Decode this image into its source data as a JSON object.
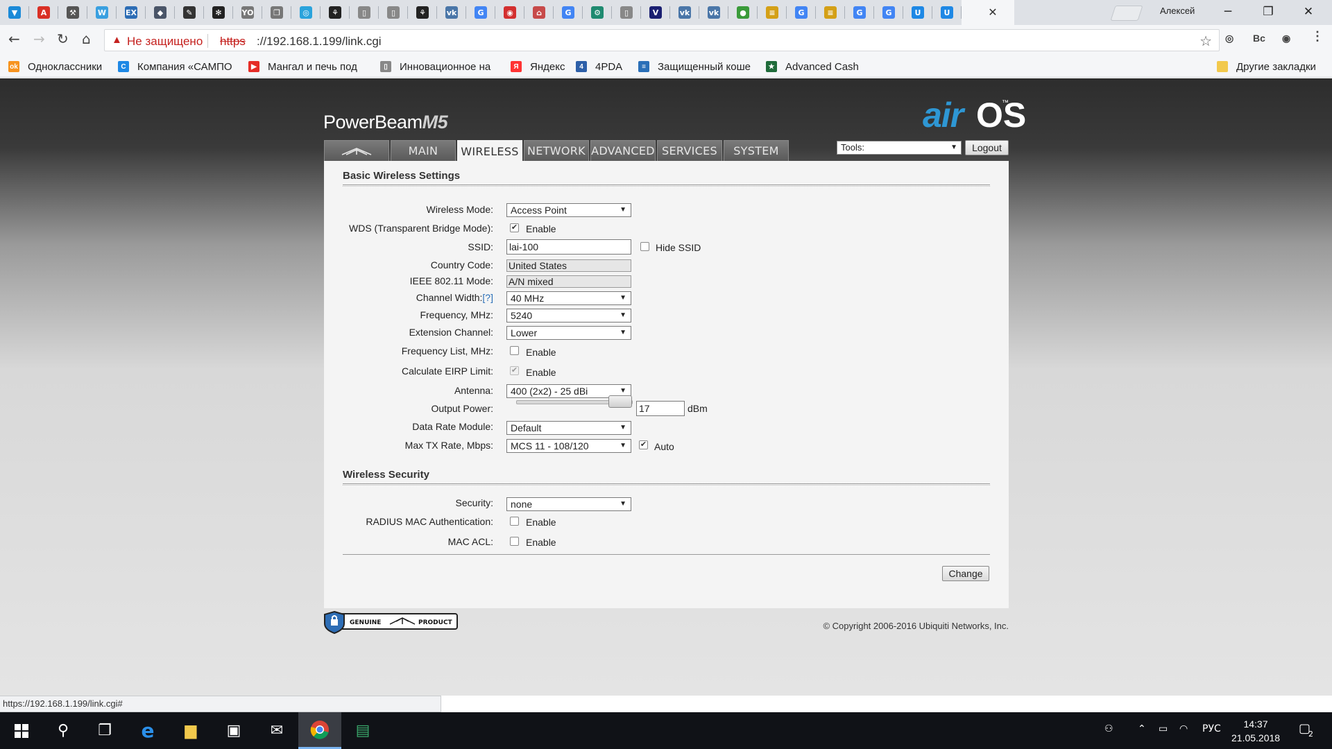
{
  "browser": {
    "tabs": [
      {
        "icon": "vivaldi-icon",
        "color": "#1b8ad8",
        "glyph": "▼"
      },
      {
        "icon": "pdf-icon",
        "color": "#d93025",
        "glyph": "A"
      },
      {
        "icon": "tools-icon",
        "color": "#555555",
        "glyph": "⚒"
      },
      {
        "icon": "w-icon",
        "color": "#3aa0e0",
        "glyph": "W"
      },
      {
        "icon": "ex-icon",
        "color": "#2d6db5",
        "glyph": "EX"
      },
      {
        "icon": "puzzle-icon",
        "color": "#4a5568",
        "glyph": "◆"
      },
      {
        "icon": "lightning-icon",
        "color": "#333333",
        "glyph": "✎"
      },
      {
        "icon": "fan-icon",
        "color": "#222222",
        "glyph": "✻"
      },
      {
        "icon": "yo-icon",
        "color": "#777777",
        "glyph": "YO"
      },
      {
        "icon": "pages-icon",
        "color": "#777777",
        "glyph": "❐"
      },
      {
        "icon": "telegram-icon",
        "color": "#2aa3dc",
        "glyph": "◎"
      },
      {
        "icon": "yoga-icon",
        "color": "#222222",
        "glyph": "⚘"
      },
      {
        "icon": "page-icon",
        "color": "#888888",
        "glyph": "▯"
      },
      {
        "icon": "page-icon",
        "color": "#888888",
        "glyph": "▯"
      },
      {
        "icon": "yoga-icon",
        "color": "#222222",
        "glyph": "⚘"
      },
      {
        "icon": "vk-icon",
        "color": "#4a76a8",
        "glyph": "vk"
      },
      {
        "icon": "google-icon",
        "color": "#4285f4",
        "glyph": "G"
      },
      {
        "icon": "mask-icon",
        "color": "#d32f2f",
        "glyph": "◉"
      },
      {
        "icon": "gift-icon",
        "color": "#c74a4a",
        "glyph": "⌂"
      },
      {
        "icon": "google-icon",
        "color": "#4285f4",
        "glyph": "G"
      },
      {
        "icon": "gear-icon",
        "color": "#1f8a70",
        "glyph": "⚙"
      },
      {
        "icon": "page-icon",
        "color": "#888888",
        "glyph": "▯"
      },
      {
        "icon": "visa-icon",
        "color": "#1a1f71",
        "glyph": "V"
      },
      {
        "icon": "vk-icon",
        "color": "#4a76a8",
        "glyph": "vk"
      },
      {
        "icon": "vk-icon",
        "color": "#4a76a8",
        "glyph": "vk"
      },
      {
        "icon": "ball-icon",
        "color": "#3a9b3a",
        "glyph": "●"
      },
      {
        "icon": "chart-icon",
        "color": "#d4a017",
        "glyph": "≡"
      },
      {
        "icon": "google-icon",
        "color": "#4285f4",
        "glyph": "G"
      },
      {
        "icon": "chart-icon",
        "color": "#d4a017",
        "glyph": "≡"
      },
      {
        "icon": "google-icon",
        "color": "#4285f4",
        "glyph": "G"
      },
      {
        "icon": "google-icon",
        "color": "#4285f4",
        "glyph": "G"
      },
      {
        "icon": "u-icon",
        "color": "#1e88e5",
        "glyph": "U"
      },
      {
        "icon": "u-icon",
        "color": "#1e88e5",
        "glyph": "U"
      }
    ],
    "profile_name": "Алексей",
    "security_label": "Не защищено",
    "url_protocol": "https",
    "url_rest": "://192.168.1.199/link.cgi",
    "status_url": "https://192.168.1.199/link.cgi#"
  },
  "bookmarks": [
    {
      "label": "Одноклассники",
      "color": "#f7931e",
      "glyph": "ok"
    },
    {
      "label": "Компания «САМПО",
      "color": "#1e88e5",
      "glyph": "C"
    },
    {
      "label": "Мангал и печь под",
      "color": "#e52d27",
      "glyph": "▶"
    },
    {
      "label": "Инновационное на",
      "color": "#888888",
      "glyph": "▯"
    },
    {
      "label": "Яндекс",
      "color": "#ff3333",
      "glyph": "Я"
    },
    {
      "label": "4PDA",
      "color": "#2d5fa8",
      "glyph": "4"
    },
    {
      "label": "Защищенный коше",
      "color": "#2a6fb8",
      "glyph": "≡"
    },
    {
      "label": "Advanced Cash",
      "color": "#1f6b3a",
      "glyph": "★"
    }
  ],
  "other_bookmarks": "Другие закладки",
  "device": {
    "product": "PowerBeam",
    "model": "M5",
    "os_air": "air",
    "os_name": "OS",
    "os_tm": "™"
  },
  "nav_tabs": [
    "MAIN",
    "WIRELESS",
    "NETWORK",
    "ADVANCED",
    "SERVICES",
    "SYSTEM"
  ],
  "tools": {
    "label": "Tools:",
    "logout": "Logout"
  },
  "basic": {
    "title": "Basic Wireless Settings",
    "wireless_mode_label": "Wireless Mode:",
    "wireless_mode": "Access Point",
    "wds_label": "WDS (Transparent Bridge Mode):",
    "enable": "Enable",
    "ssid_label": "SSID:",
    "ssid": "lai-100",
    "hide_ssid": "Hide SSID",
    "country_label": "Country Code:",
    "country": "United States",
    "ieee_label": "IEEE 802.11 Mode:",
    "ieee": "A/N mixed",
    "channel_width_label": "Channel Width:",
    "help": "[?]",
    "channel_width": "40 MHz",
    "frequency_label": "Frequency, MHz:",
    "frequency": "5240",
    "ext_channel_label": "Extension Channel:",
    "ext_channel": "Lower",
    "freq_list_label": "Frequency List, MHz:",
    "eirp_label": "Calculate EIRP Limit:",
    "antenna_label": "Antenna:",
    "antenna": "400 (2x2) - 25 dBi",
    "output_power_label": "Output Power:",
    "output_power": "17",
    "output_power_unit": "dBm",
    "data_rate_label": "Data Rate Module:",
    "data_rate": "Default",
    "max_tx_label": "Max TX Rate, Mbps:",
    "max_tx": "MCS 11 - 108/120",
    "auto": "Auto"
  },
  "security": {
    "title": "Wireless Security",
    "security_label": "Security:",
    "security": "none",
    "radius_label": "RADIUS MAC Authentication:",
    "macacl_label": "MAC ACL:",
    "enable": "Enable"
  },
  "footer": {
    "change": "Change",
    "genuine": "GENUINE",
    "product": "PRODUCT",
    "copyright": "© Copyright 2006-2016 Ubiquiti Networks, Inc."
  },
  "taskbar": {
    "lang": "РУС",
    "time": "14:37",
    "date": "21.05.2018",
    "notifications": "2"
  }
}
